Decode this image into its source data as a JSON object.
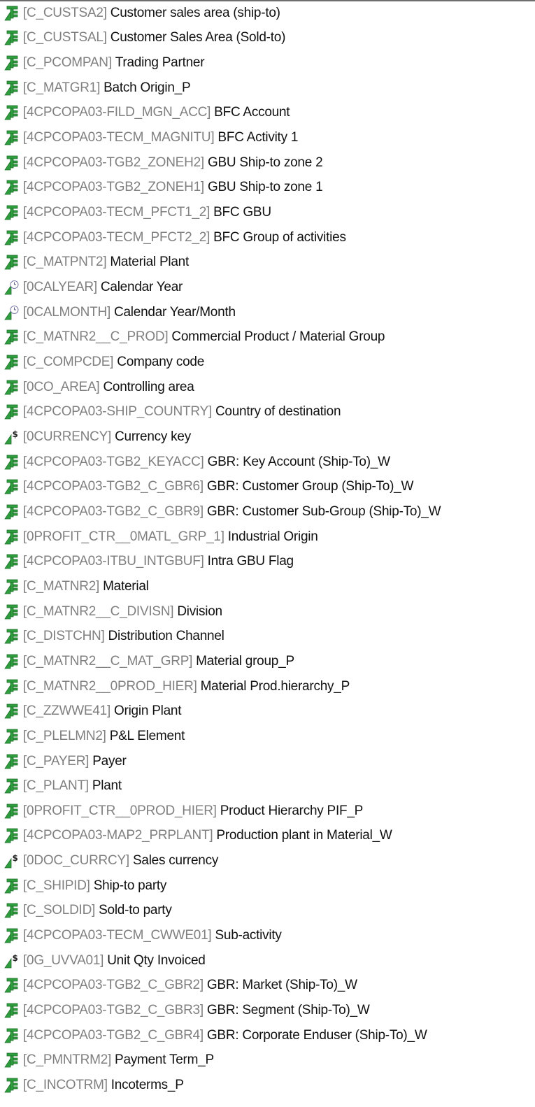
{
  "tree": {
    "items": [
      {
        "tech": "[C_CUSTSA2]",
        "desc": "Customer sales area (ship-to)",
        "icon": "characteristic-icon"
      },
      {
        "tech": "[C_CUSTSAL]",
        "desc": "Customer Sales Area (Sold-to)",
        "icon": "characteristic-icon"
      },
      {
        "tech": "[C_PCOMPAN]",
        "desc": "Trading Partner",
        "icon": "characteristic-icon"
      },
      {
        "tech": "[C_MATGR1]",
        "desc": "Batch Origin_P",
        "icon": "characteristic-icon"
      },
      {
        "tech": "[4CPCOPA03-FILD_MGN_ACC]",
        "desc": "BFC Account",
        "icon": "characteristic-icon"
      },
      {
        "tech": "[4CPCOPA03-TECM_MAGNITU]",
        "desc": "BFC Activity 1",
        "icon": "characteristic-icon"
      },
      {
        "tech": "[4CPCOPA03-TGB2_ZONEH2]",
        "desc": "GBU Ship-to zone 2",
        "icon": "characteristic-icon"
      },
      {
        "tech": "[4CPCOPA03-TGB2_ZONEH1]",
        "desc": "GBU Ship-to zone 1",
        "icon": "characteristic-icon"
      },
      {
        "tech": "[4CPCOPA03-TECM_PFCT1_2]",
        "desc": "BFC GBU",
        "icon": "characteristic-icon"
      },
      {
        "tech": "[4CPCOPA03-TECM_PFCT2_2]",
        "desc": "BFC Group of activities",
        "icon": "characteristic-icon"
      },
      {
        "tech": "[C_MATPNT2]",
        "desc": "Material Plant",
        "icon": "characteristic-icon"
      },
      {
        "tech": "[0CALYEAR]",
        "desc": "Calendar Year",
        "icon": "time-characteristic-icon"
      },
      {
        "tech": "[0CALMONTH]",
        "desc": "Calendar Year/Month",
        "icon": "time-characteristic-icon"
      },
      {
        "tech": "[C_MATNR2__C_PROD]",
        "desc": "Commercial Product / Material Group",
        "icon": "characteristic-icon"
      },
      {
        "tech": "[C_COMPCDE]",
        "desc": "Company code",
        "icon": "characteristic-icon"
      },
      {
        "tech": "[0CO_AREA]",
        "desc": "Controlling area",
        "icon": "characteristic-icon"
      },
      {
        "tech": "[4CPCOPA03-SHIP_COUNTRY]",
        "desc": "Country of destination",
        "icon": "characteristic-icon"
      },
      {
        "tech": "[0CURRENCY]",
        "desc": "Currency key",
        "icon": "unit-characteristic-icon"
      },
      {
        "tech": "[4CPCOPA03-TGB2_KEYACC]",
        "desc": "GBR: Key Account (Ship-To)_W",
        "icon": "characteristic-icon"
      },
      {
        "tech": "[4CPCOPA03-TGB2_C_GBR6]",
        "desc": "GBR: Customer Group (Ship-To)_W",
        "icon": "characteristic-icon"
      },
      {
        "tech": "[4CPCOPA03-TGB2_C_GBR9]",
        "desc": "GBR: Customer Sub-Group (Ship-To)_W",
        "icon": "characteristic-icon"
      },
      {
        "tech": "[0PROFIT_CTR__0MATL_GRP_1]",
        "desc": "Industrial Origin",
        "icon": "characteristic-icon"
      },
      {
        "tech": "[4CPCOPA03-ITBU_INTGBUF]",
        "desc": "Intra GBU Flag",
        "icon": "characteristic-icon"
      },
      {
        "tech": "[C_MATNR2]",
        "desc": "Material",
        "icon": "characteristic-icon"
      },
      {
        "tech": "[C_MATNR2__C_DIVISN]",
        "desc": "Division",
        "icon": "characteristic-icon"
      },
      {
        "tech": "[C_DISTCHN]",
        "desc": "Distribution Channel",
        "icon": "characteristic-icon"
      },
      {
        "tech": "[C_MATNR2__C_MAT_GRP]",
        "desc": "Material group_P",
        "icon": "characteristic-icon"
      },
      {
        "tech": "[C_MATNR2__0PROD_HIER]",
        "desc": "Material Prod.hierarchy_P",
        "icon": "characteristic-icon"
      },
      {
        "tech": "[C_ZZWWE41]",
        "desc": "Origin Plant",
        "icon": "characteristic-icon"
      },
      {
        "tech": "[C_PLELMN2]",
        "desc": "P&L Element",
        "icon": "characteristic-icon"
      },
      {
        "tech": "[C_PAYER]",
        "desc": "Payer",
        "icon": "characteristic-icon"
      },
      {
        "tech": "[C_PLANT]",
        "desc": "Plant",
        "icon": "characteristic-icon"
      },
      {
        "tech": "[0PROFIT_CTR__0PROD_HIER]",
        "desc": "Product Hierarchy PIF_P",
        "icon": "characteristic-icon"
      },
      {
        "tech": "[4CPCOPA03-MAP2_PRPLANT]",
        "desc": "Production plant in Material_W",
        "icon": "characteristic-icon"
      },
      {
        "tech": "[0DOC_CURRCY]",
        "desc": "Sales currency",
        "icon": "unit-characteristic-icon"
      },
      {
        "tech": "[C_SHIPID]",
        "desc": "Ship-to party",
        "icon": "characteristic-icon"
      },
      {
        "tech": "[C_SOLDID]",
        "desc": "Sold-to party",
        "icon": "characteristic-icon"
      },
      {
        "tech": "[4CPCOPA03-TECM_CWWE01]",
        "desc": "Sub-activity",
        "icon": "characteristic-icon"
      },
      {
        "tech": "[0G_UVVA01]",
        "desc": "Unit Qty Invoiced",
        "icon": "unit-characteristic-icon"
      },
      {
        "tech": "[4CPCOPA03-TGB2_C_GBR2]",
        "desc": "GBR: Market (Ship-To)_W",
        "icon": "characteristic-icon"
      },
      {
        "tech": "[4CPCOPA03-TGB2_C_GBR3]",
        "desc": "GBR: Segment (Ship-To)_W",
        "icon": "characteristic-icon"
      },
      {
        "tech": "[4CPCOPA03-TGB2_C_GBR4]",
        "desc": "GBR: Corporate Enduser (Ship-To)_W",
        "icon": "characteristic-icon"
      },
      {
        "tech": "[C_PMNTRM2]",
        "desc": "Payment Term_P",
        "icon": "characteristic-icon"
      },
      {
        "tech": "[C_INCOTRM]",
        "desc": "Incoterms_P",
        "icon": "characteristic-icon"
      }
    ]
  },
  "colors": {
    "icon_green": "#2e9e3e",
    "icon_dark_green": "#1f6e2a",
    "tech_gray": "#808080",
    "text": "#111111"
  }
}
